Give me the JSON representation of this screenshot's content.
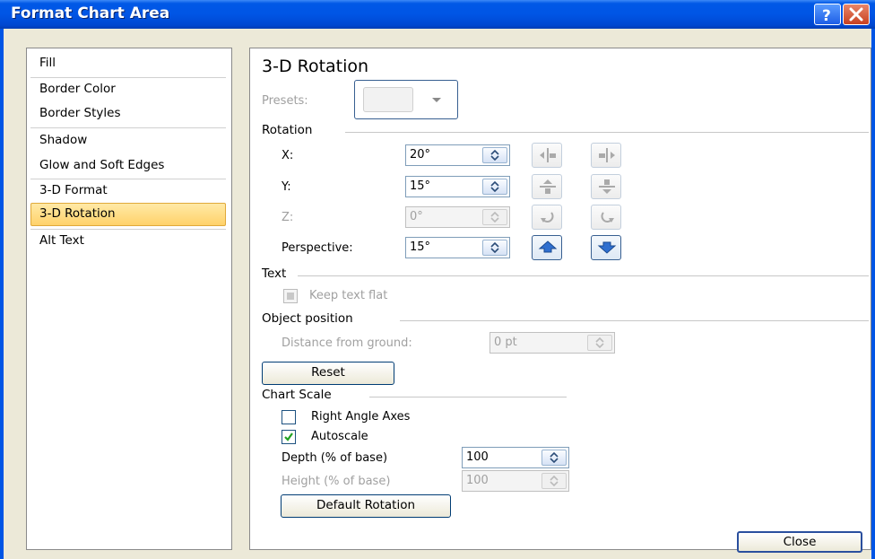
{
  "window": {
    "title": "Format Chart Area",
    "help_icon": "help-icon",
    "close_icon": "close-icon"
  },
  "nav": {
    "items": [
      {
        "label": "Fill"
      },
      {
        "label": "Border Color"
      },
      {
        "label": "Border Styles"
      },
      {
        "label": "Shadow"
      },
      {
        "label": "Glow and Soft Edges"
      },
      {
        "label": "3-D Format"
      },
      {
        "label": "3-D Rotation",
        "selected": true
      },
      {
        "label": "Alt Text"
      }
    ]
  },
  "panel": {
    "heading": "3-D Rotation",
    "presets_label": "Presets:",
    "rotation": {
      "section": "Rotation",
      "x_label": "X:",
      "x_value": "20°",
      "y_label": "Y:",
      "y_value": "15°",
      "z_label": "Z:",
      "z_value": "0°",
      "perspective_label": "Perspective:",
      "perspective_value": "15°"
    },
    "text_section": "Text",
    "keep_text_flat": "Keep text flat",
    "object_position": {
      "section": "Object position",
      "distance_label": "Distance from ground:",
      "distance_value": "0 pt"
    },
    "reset_label": "Reset",
    "chart_scale": {
      "section": "Chart Scale",
      "right_angle_axes": "Right Angle Axes",
      "right_angle_axes_checked": false,
      "autoscale": "Autoscale",
      "autoscale_checked": true,
      "depth_label": "Depth (% of base)",
      "depth_value": "100",
      "height_label": "Height (% of base)",
      "height_value": "100",
      "default_rotation_label": "Default Rotation"
    }
  },
  "footer": {
    "close_label": "Close"
  },
  "colors": {
    "titlebar": "#0055e5",
    "selection": "#ffd26a",
    "dialog_bg": "#ece9d8"
  }
}
